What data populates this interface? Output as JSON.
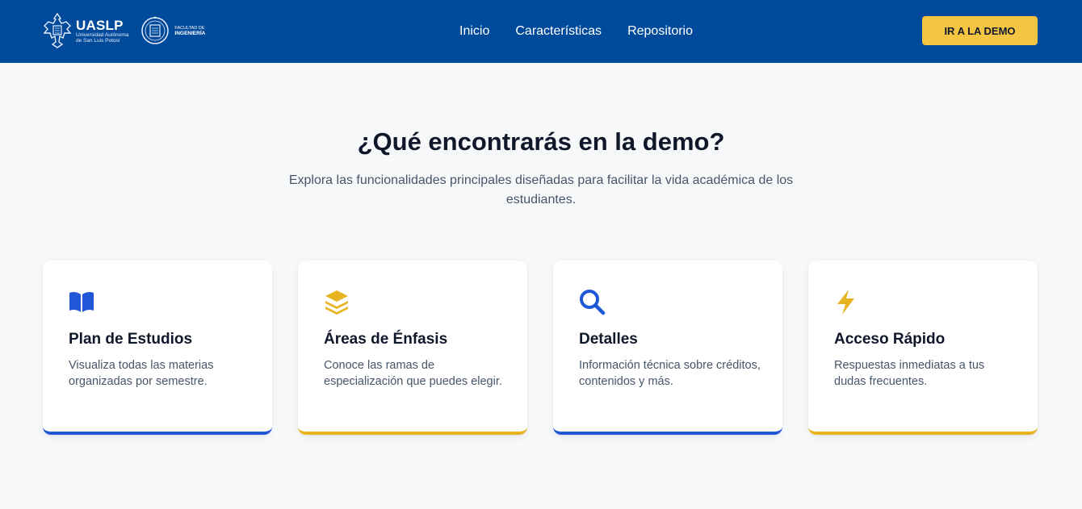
{
  "header": {
    "logos": {
      "uaslp_name": "UASLP",
      "uaslp_sub_line1": "Universidad Autónoma",
      "uaslp_sub_line2": "de San Luis Potosí",
      "faculty_line1": "FACULTAD DE",
      "faculty_line2": "INGENIERÍA"
    },
    "nav": [
      "Inicio",
      "Características",
      "Repositorio"
    ],
    "cta_label": "IR A LA DEMO"
  },
  "section": {
    "title": "¿Qué encontrarás en la demo?",
    "subtitle": "Explora las funcionalidades principales diseñadas para facilitar la vida académica de los estudiantes."
  },
  "cards": [
    {
      "icon": "book-icon",
      "title": "Plan de Estudios",
      "description": "Visualiza todas las materias organizadas por semestre.",
      "accent": "#1f57d6"
    },
    {
      "icon": "layers-icon",
      "title": "Áreas de Énfasis",
      "description": "Conoce las ramas de especialización que puedes elegir.",
      "accent": "#e8b321"
    },
    {
      "icon": "search-icon",
      "title": "Detalles",
      "description": "Información técnica sobre créditos, contenidos y más.",
      "accent": "#1f57d6"
    },
    {
      "icon": "lightning-icon",
      "title": "Acceso Rápido",
      "description": "Respuestas inmediatas a tus dudas frecuentes.",
      "accent": "#e8b321"
    }
  ],
  "colors": {
    "navbar": "#004a9b",
    "cta": "#f4c542",
    "blue_accent": "#1f57d6",
    "yellow_accent": "#e8b321"
  }
}
